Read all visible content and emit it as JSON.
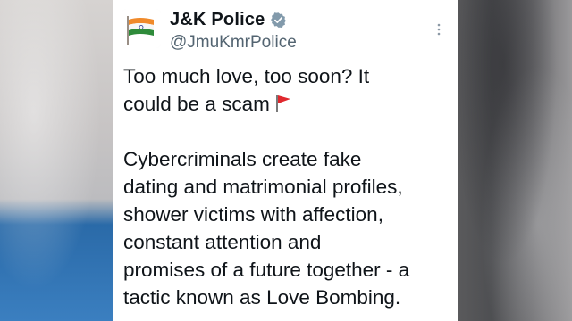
{
  "tweet": {
    "display_name": "J&K Police",
    "handle": "@JmuKmrPolice",
    "icons": {
      "verified": "verified-badge-icon",
      "more": "more-options-icon",
      "flag": "red-flag-emoji-icon",
      "avatar": "india-flag-avatar"
    },
    "paragraph1": [
      "Too much love, too soon? It",
      "could be a scam"
    ],
    "paragraph2": [
      "Cybercriminals create fake",
      "dating and matrimonial profiles,",
      "shower victims with affection,",
      "constant attention and",
      "promises of a future together - a",
      "tactic known as Love Bombing."
    ]
  },
  "colors": {
    "name": "#0f1419",
    "handle": "#536471",
    "verified_badge": "#829aab",
    "flag": "#e0282e"
  }
}
